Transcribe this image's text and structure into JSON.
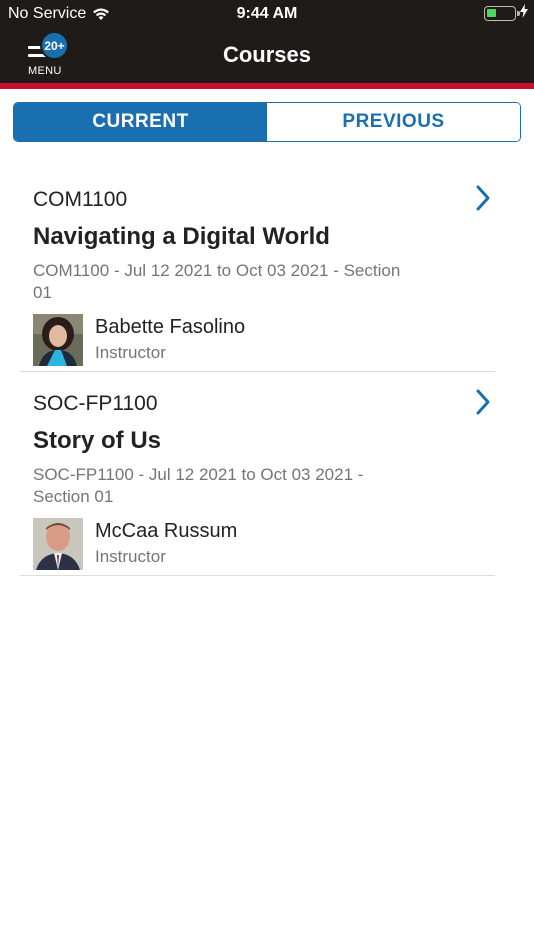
{
  "status_bar": {
    "carrier": "No Service",
    "time": "9:44 AM"
  },
  "nav": {
    "title": "Courses",
    "menu_label": "MENU",
    "menu_badge": "20+"
  },
  "tabs": {
    "current": "CURRENT",
    "previous": "PREVIOUS",
    "selected": "current"
  },
  "courses": [
    {
      "code": "COM1100",
      "title": "Navigating a Digital World",
      "meta": "COM1100 - Jul 12 2021 to Oct 03 2021 - Section 01",
      "instructor_name": "Babette Fasolino",
      "instructor_role": "Instructor"
    },
    {
      "code": "SOC-FP1100",
      "title": "Story of Us",
      "meta": "SOC-FP1100 - Jul 12 2021 to Oct 03 2021 - Section 01",
      "instructor_name": "McCaa Russum",
      "instructor_role": "Instructor"
    }
  ],
  "colors": {
    "accent": "#1a6fb1",
    "header": "#1f1b18",
    "brand_red": "#c8102e"
  }
}
